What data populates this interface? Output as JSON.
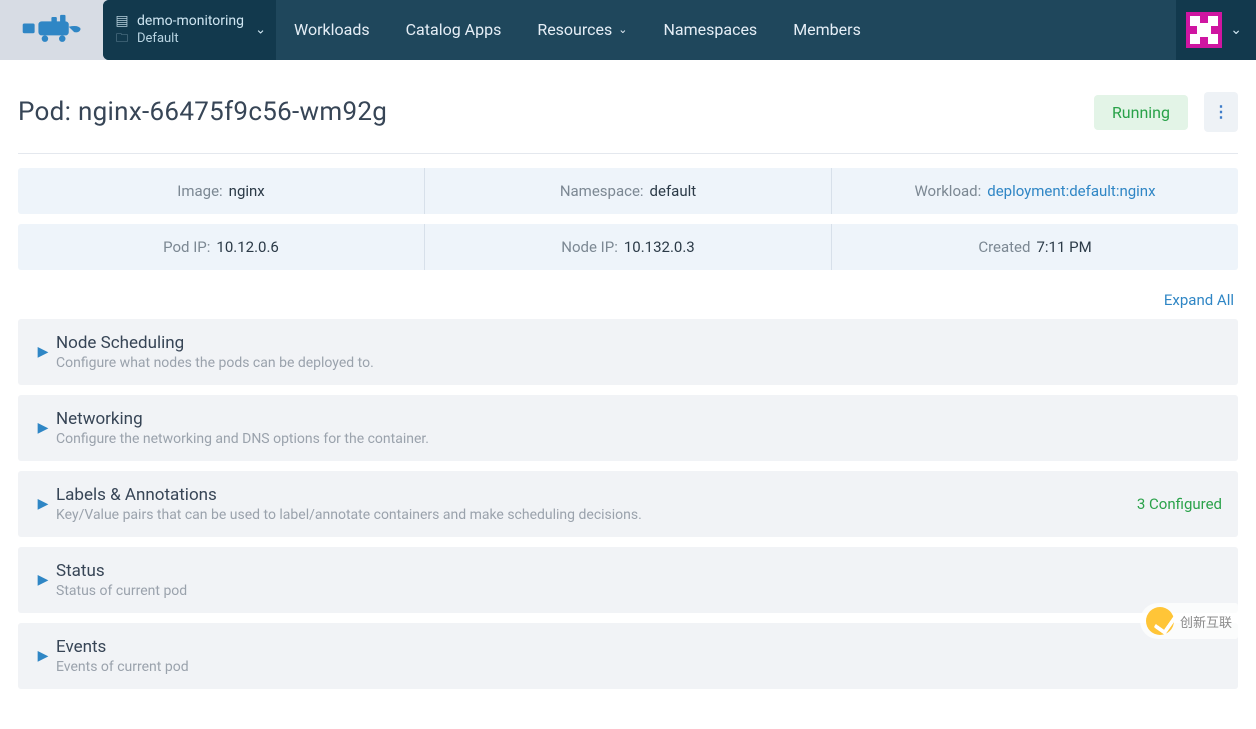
{
  "header": {
    "cluster_name": "demo-monitoring",
    "project_name": "Default"
  },
  "nav": {
    "workloads": "Workloads",
    "catalog_apps": "Catalog Apps",
    "resources": "Resources",
    "namespaces": "Namespaces",
    "members": "Members"
  },
  "title": {
    "prefix": "Pod:",
    "name": "nginx-66475f9c56-wm92g"
  },
  "status_badge": "Running",
  "info": {
    "image_label": "Image:",
    "image_value": "nginx",
    "namespace_label": "Namespace:",
    "namespace_value": "default",
    "workload_label": "Workload:",
    "workload_value": "deployment:default:nginx",
    "pod_ip_label": "Pod IP:",
    "pod_ip_value": "10.12.0.6",
    "node_ip_label": "Node IP:",
    "node_ip_value": "10.132.0.3",
    "created_label": "Created",
    "created_value": "7:11 PM"
  },
  "expand_all": "Expand All",
  "accordions": {
    "node_scheduling": {
      "title": "Node Scheduling",
      "sub": "Configure what nodes the pods can be deployed to."
    },
    "networking": {
      "title": "Networking",
      "sub": "Configure the networking and DNS options for the container."
    },
    "labels": {
      "title": "Labels & Annotations",
      "sub": "Key/Value pairs that can be used to label/annotate containers and make scheduling decisions.",
      "right": "3 Configured"
    },
    "status": {
      "title": "Status",
      "sub": "Status of current pod"
    },
    "events": {
      "title": "Events",
      "sub": "Events of current pod"
    }
  },
  "overlay_text": "创新互联"
}
